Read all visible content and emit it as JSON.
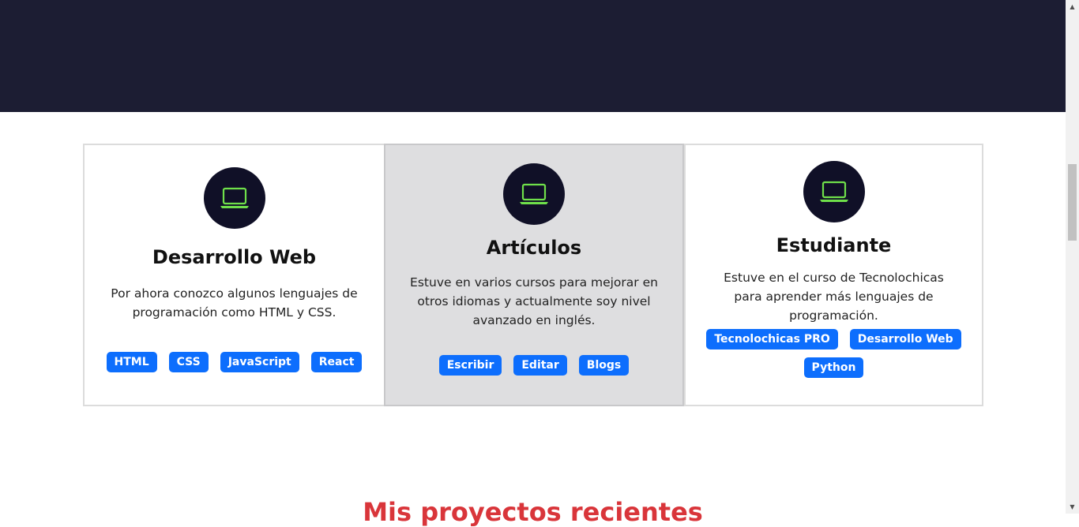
{
  "cards": [
    {
      "icon": "laptop-icon",
      "title": "Desarrollo Web",
      "description": "Por ahora conozco algunos lenguajes de programación como HTML y CSS.",
      "tags": [
        "HTML",
        "CSS",
        "JavaScript",
        "React"
      ]
    },
    {
      "icon": "laptop-icon",
      "title": "Artículos",
      "description": "Estuve en varios cursos para mejorar en otros idiomas y actualmente soy nivel avanzado en inglés.",
      "tags": [
        "Escribir",
        "Editar",
        "Blogs"
      ]
    },
    {
      "icon": "laptop-icon",
      "title": "Estudiante",
      "description": "Estuve en el curso de Tecnolochicas para aprender más lenguajes de programación.",
      "tags": [
        "Tecnolochicas PRO",
        "Desarrollo Web",
        "Python"
      ]
    }
  ],
  "section_title": "Mis proyectos recientes",
  "colors": {
    "hero_bg": "#1c1d33",
    "icon_bg": "#101027",
    "icon_stroke": "#6fe04a",
    "tag_bg": "#0d6efd",
    "section_title": "#d9353a",
    "active_card_bg": "#dedee0"
  },
  "scrollbar": {
    "up_icon": "chevron-up-icon",
    "down_icon": "chevron-down-icon"
  }
}
